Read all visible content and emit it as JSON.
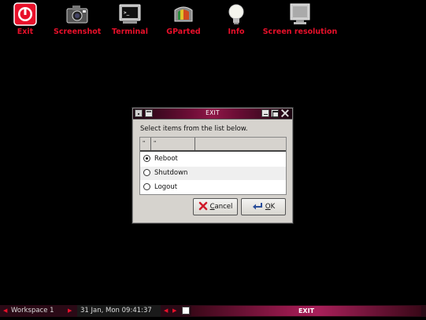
{
  "desktop": {
    "icons": [
      {
        "label": "Exit",
        "icon": "power-icon"
      },
      {
        "label": "Screenshot",
        "icon": "camera-icon"
      },
      {
        "label": "Terminal",
        "icon": "terminal-icon"
      },
      {
        "label": "GParted",
        "icon": "gparted-icon"
      },
      {
        "label": "Info",
        "icon": "lightbulb-icon"
      },
      {
        "label": "Screen resolution",
        "icon": "monitor-icon"
      }
    ]
  },
  "dialog": {
    "title": "EXIT",
    "prompt": "Select items from the list below.",
    "columns": [
      "\"",
      "\"",
      ""
    ],
    "options": [
      {
        "label": "Reboot",
        "selected": true
      },
      {
        "label": "Shutdown",
        "selected": false
      },
      {
        "label": "Logout",
        "selected": false
      }
    ],
    "cancel_label_first": "C",
    "cancel_label_rest": "ancel",
    "ok_label_first": "O",
    "ok_label_rest": "K"
  },
  "taskbar": {
    "workspace": "Workspace 1",
    "clock": "31 Jan, Mon 09:41:37",
    "task": "EXIT"
  },
  "colors": {
    "accent_red": "#e8102a",
    "titlebar": "#8e1747",
    "dialog_bg": "#d6d3ce"
  }
}
